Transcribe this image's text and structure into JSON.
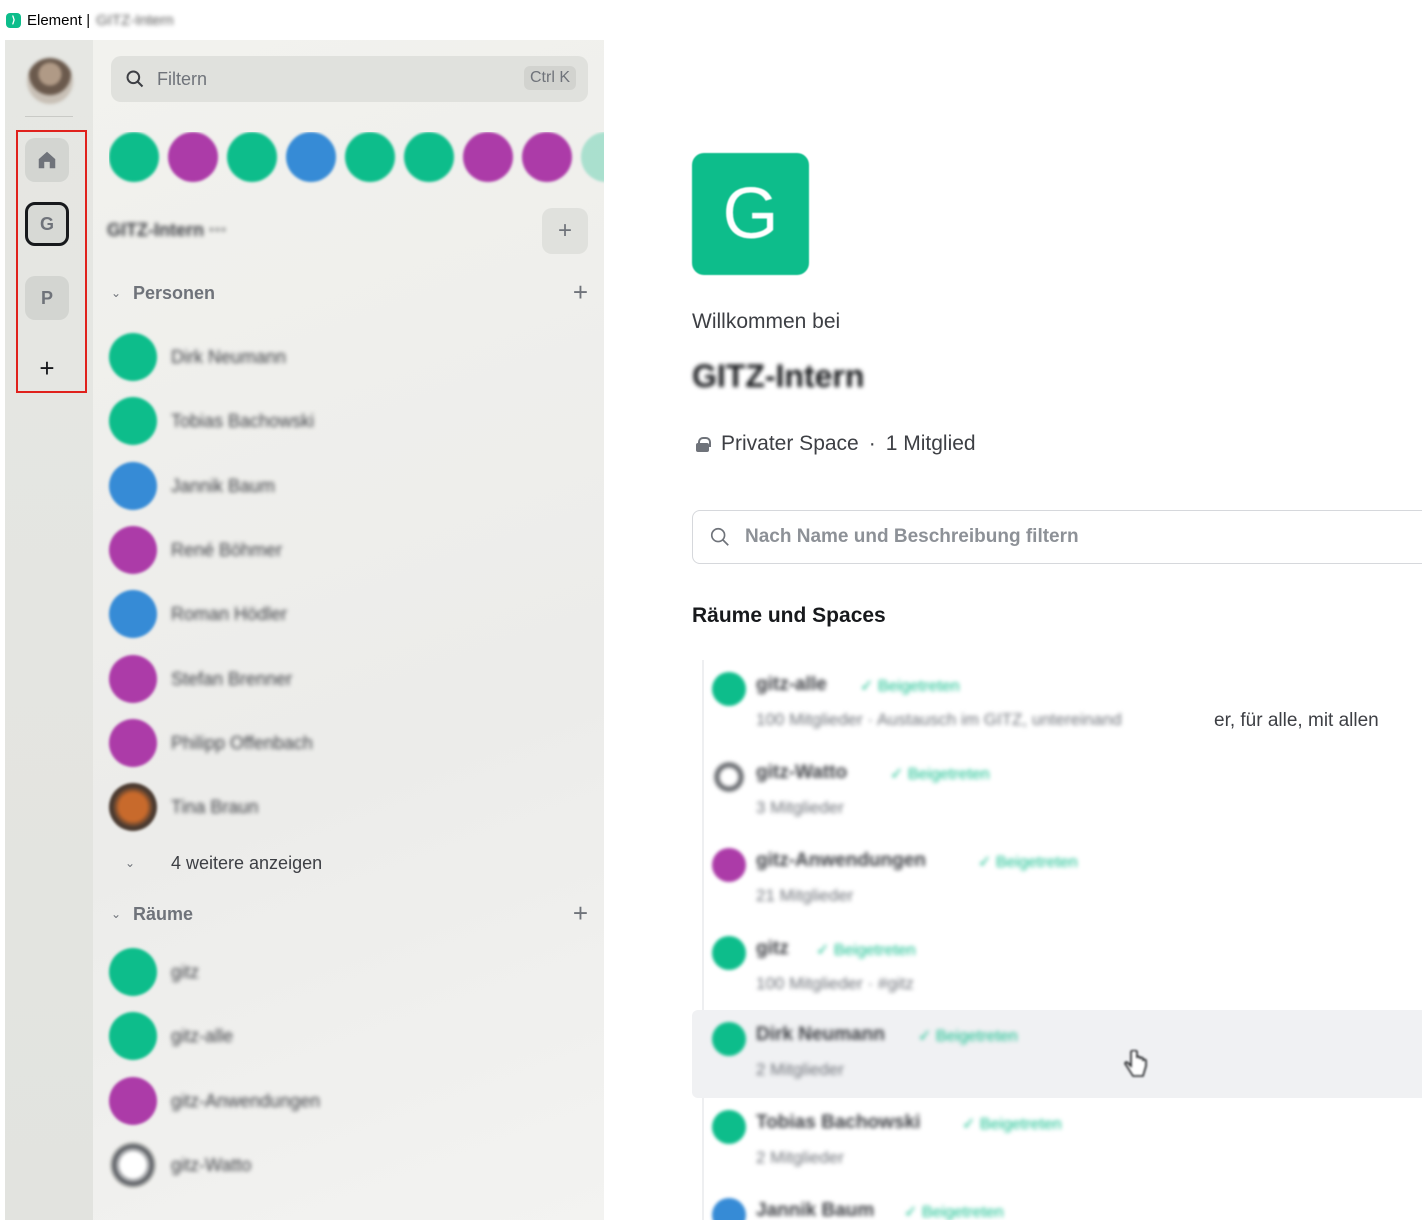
{
  "window": {
    "app_name": "Element |",
    "title_suffix": "GITZ-Intern"
  },
  "colors": {
    "accent": "#0dbd8b",
    "purple": "#ac3ba8",
    "blue": "#368bd6",
    "highlight": "#e0211c"
  },
  "spacebar": {
    "user_avatar_icon": "user-avatar",
    "tiles": [
      {
        "icon": "home-icon",
        "label": ""
      },
      {
        "label": "G"
      },
      {
        "label": "P"
      },
      {
        "icon": "plus-icon",
        "label": "+"
      }
    ]
  },
  "roomlist": {
    "filter_placeholder": "Filtern",
    "filter_shortcut": "Ctrl K",
    "space_name": "GITZ-Intern ···",
    "add_label": "+",
    "people_section": "Personen",
    "rooms_section": "Räume",
    "show_more": "4 weitere anzeigen",
    "people": [
      "Dirk Neumann",
      "Tobias Bachowski",
      "Jannik Baum",
      "René Böhmer",
      "Roman Hödler",
      "Stefan Brenner",
      "Philipp Offenbach",
      "Tina Braun"
    ],
    "rooms": [
      "gitz",
      "gitz-alle",
      "gitz-Anwendungen",
      "gitz-Watto"
    ]
  },
  "main": {
    "avatar_letter": "G",
    "welcome": "Willkommen bei",
    "space_title": "GITZ-Intern",
    "meta_privacy": "Privater Space",
    "meta_separator": "·",
    "meta_members": "1 Mitglied",
    "search_placeholder": "Nach Name und Beschreibung filtern",
    "section_title": "Räume und Spaces",
    "entries": [
      {
        "name": "gitz-alle",
        "joined": "✓ Beigetreten",
        "desc": "100 Mitglieder · Austausch im GITZ, untereinand",
        "desc_visible": "er, für alle, mit allen"
      },
      {
        "name": "gitz-Watto",
        "joined": "✓ Beigetreten",
        "desc": "3 Mitglieder",
        "desc_visible": ""
      },
      {
        "name": "gitz-Anwendungen",
        "joined": "✓ Beigetreten",
        "desc": "21 Mitglieder",
        "desc_visible": ""
      },
      {
        "name": "gitz",
        "joined": "✓ Beigetreten",
        "desc": "100 Mitglieder · #gitz",
        "desc_visible": ""
      },
      {
        "name": "Dirk Neumann",
        "joined": "✓ Beigetreten",
        "desc": "2 Mitglieder",
        "desc_visible": ""
      },
      {
        "name": "Tobias Bachowski",
        "joined": "✓ Beigetreten",
        "desc": "2 Mitglieder",
        "desc_visible": ""
      },
      {
        "name": "Jannik Baum",
        "joined": "✓ Beigetreten",
        "desc": "",
        "desc_visible": ""
      }
    ]
  }
}
